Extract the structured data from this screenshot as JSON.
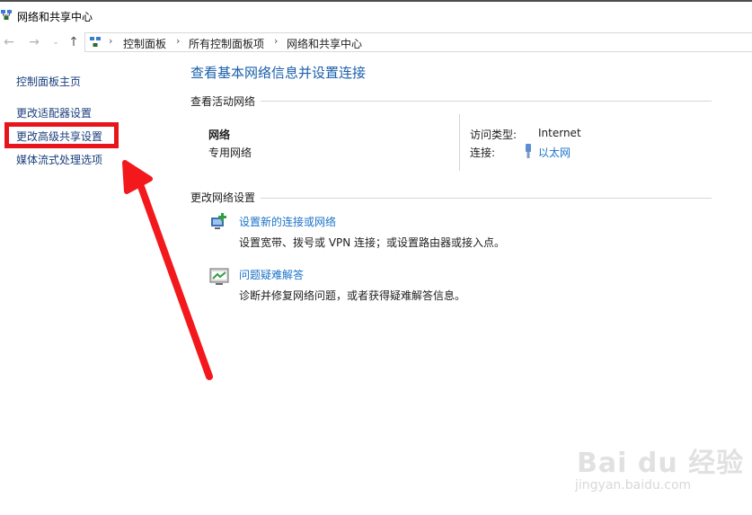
{
  "window": {
    "title": "网络和共享中心"
  },
  "navigation": {
    "back_icon": "arrow-left-icon",
    "forward_icon": "arrow-right-icon",
    "recent_icon": "chevron-down-icon",
    "up_icon": "arrow-up-icon",
    "breadcrumbs": [
      "控制面板",
      "所有控制面板项",
      "网络和共享中心"
    ]
  },
  "sidebar": {
    "items": [
      {
        "label": "控制面板主页"
      },
      {
        "label": "更改适配器设置"
      },
      {
        "label": "更改高级共享设置"
      },
      {
        "label": "媒体流式处理选项"
      }
    ],
    "highlight_color": "#e8141b"
  },
  "main": {
    "title": "查看基本网络信息并设置连接",
    "active_networks_header": "查看活动网络",
    "network": {
      "name": "网络",
      "type": "专用网络",
      "access_type_label": "访问类型:",
      "access_type_value": "Internet",
      "connections_label": "连接:",
      "connections_value": "以太网"
    },
    "change_settings_header": "更改网络设置",
    "tasks": [
      {
        "icon": "new-connection-icon",
        "link": "设置新的连接或网络",
        "desc": "设置宽带、拨号或 VPN 连接；或设置路由器或接入点。"
      },
      {
        "icon": "troubleshoot-icon",
        "link": "问题疑难解答",
        "desc": "诊断并修复网络问题，或者获得疑难解答信息。"
      }
    ]
  },
  "annotation": {
    "arrow_color": "#f2181c"
  },
  "watermark": {
    "logo": "Bai du 经验",
    "url": "jingyan.baidu.com"
  }
}
